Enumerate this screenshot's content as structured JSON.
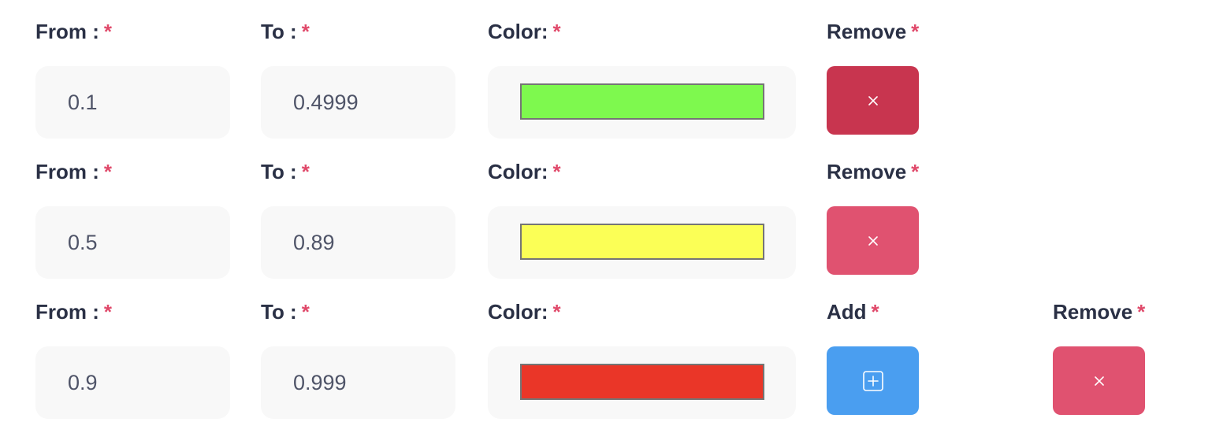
{
  "labels": {
    "from": "From :",
    "to": "To :",
    "color": "Color:",
    "remove": "Remove",
    "add": "Add",
    "required_marker": "*"
  },
  "ranges": [
    {
      "from": "0.1",
      "to": "0.4999",
      "color": "#7ef94e",
      "remove_button_color": "#c8354f"
    },
    {
      "from": "0.5",
      "to": "0.89",
      "color": "#fbff56",
      "remove_button_color": "#e05270"
    },
    {
      "from": "0.9",
      "to": "0.999",
      "color": "#ea3628",
      "remove_button_color": "#e05270"
    }
  ],
  "icons": {
    "remove": "close-icon",
    "add": "plus-square-icon"
  },
  "colors": {
    "add_button": "#4a9ef0",
    "required_marker": "#e0496a",
    "label_text": "#2a3045"
  }
}
